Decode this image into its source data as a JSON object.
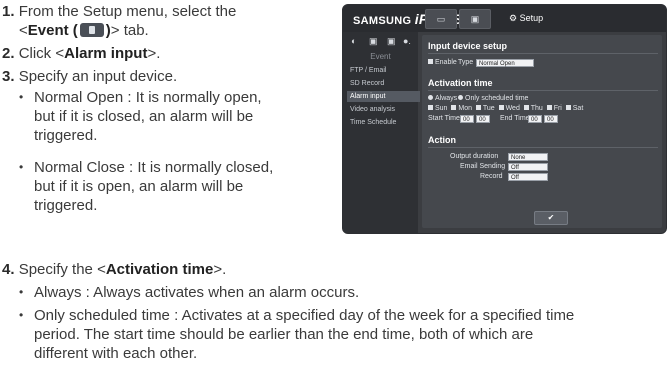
{
  "steps": {
    "s1": {
      "num": "1.",
      "text_a": "From the Setup menu, select the",
      "text_b_pre": "<",
      "text_b_bold": "Event (",
      "text_b_bold2": ")",
      "text_b_post": "> tab."
    },
    "s2": {
      "num": "2.",
      "pre": "Click <",
      "bold": "Alarm input",
      "post": ">."
    },
    "s3": {
      "num": "3.",
      "text": "Specify an input device."
    },
    "s3_bullets": [
      {
        "line1": "Normal Open : It is normally open,",
        "line2": "but if it is closed, an alarm will be",
        "line3": "triggered."
      },
      {
        "line1": "Normal Close : It is normally closed,",
        "line2": "but if it is open, an alarm will be",
        "line3": "triggered."
      }
    ],
    "s4": {
      "num": "4.",
      "pre": "Specify the <",
      "bold": "Activation time",
      "post": ">."
    },
    "s4_bullets": [
      {
        "line1": "Always : Always activates when an alarm occurs."
      },
      {
        "line1": "Only scheduled time : Activates at a specified day of the week for a specified time",
        "line2": "period. The start time should be earlier than the end time, both of which are",
        "line3": "different with each other."
      }
    ]
  },
  "bullet_glyph": "•",
  "screenshot": {
    "brand_pre": "SAMSUNG",
    "brand_logo": "iPOLiS",
    "tab_labels": [
      "▭",
      "▣",
      "⚙"
    ],
    "setup_label": "Setup",
    "side_icons": [
      "◐",
      "▣",
      "▣",
      "●."
    ],
    "side_title": "Event",
    "side_items": [
      "FTP / Email",
      "SD Record",
      "Alarm input",
      "Video analysis",
      "Time Schedule"
    ],
    "active_item": "Alarm input",
    "section1": "Input device setup",
    "enable_label": "Enable",
    "type_label": "Type",
    "type_value": "Normal Open",
    "section2": "Activation time",
    "always_label": "Always",
    "only_label": "Only scheduled time",
    "days": [
      "Sun",
      "Mon",
      "Tue",
      "Wed",
      "Thu",
      "Fri",
      "Sat"
    ],
    "start_label": "Start Time",
    "end_label": "End Time",
    "time_values": [
      "00",
      "00",
      "00",
      "00"
    ],
    "section3": "Action",
    "output_label": "Output duration",
    "output_value": "None",
    "email_label": "Email Sending",
    "email_value": "Off",
    "record_label": "Record",
    "record_value": "Off",
    "ok_glyph": "✔"
  },
  "colors": {
    "panel": "#45484d",
    "topbar": "#2a2c30",
    "sidebar": "#2e3034"
  }
}
